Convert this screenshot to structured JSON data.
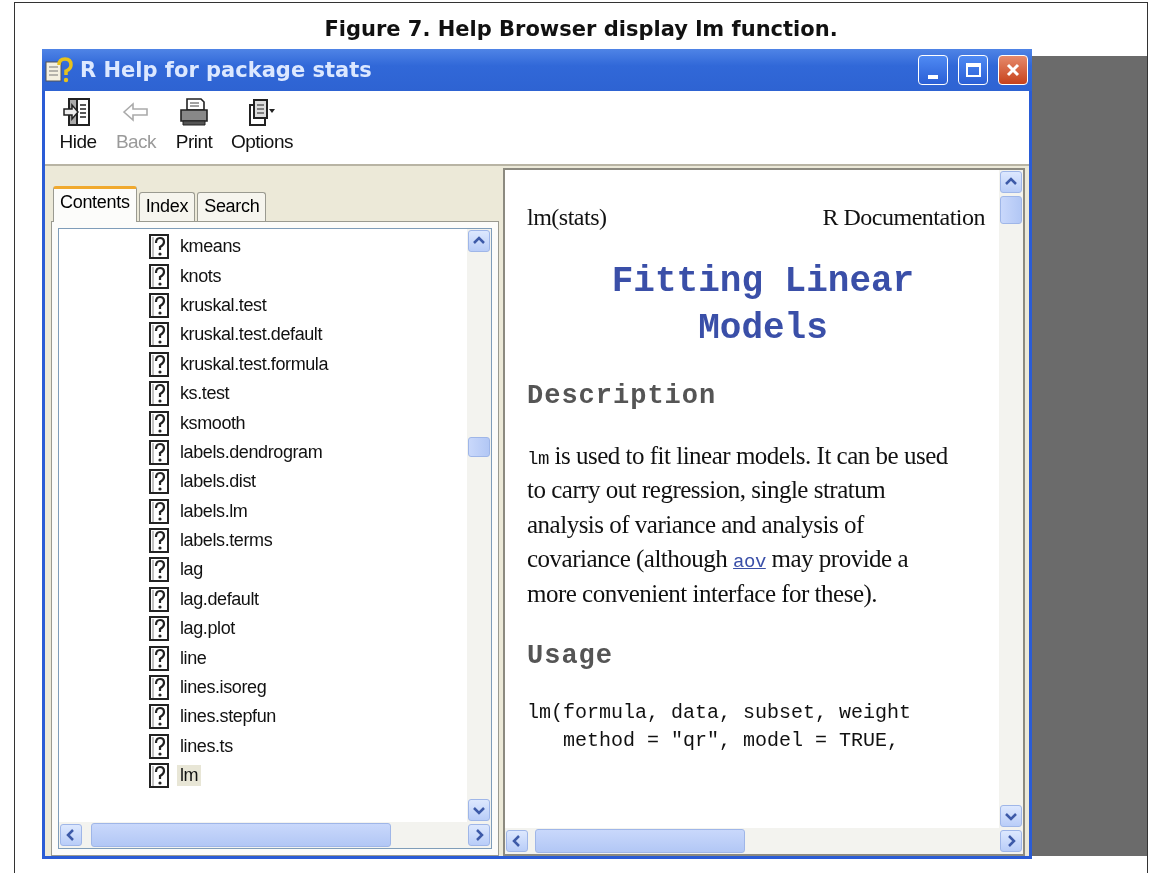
{
  "figure_caption": "Figure 7.  Help Browser display lm function.",
  "window": {
    "title": "R Help for package stats",
    "controls": [
      {
        "kind": "minimize"
      },
      {
        "kind": "maximize"
      },
      {
        "kind": "close"
      }
    ]
  },
  "toolbar": [
    {
      "kind": "hide",
      "label": "Hide",
      "disabled": false
    },
    {
      "kind": "back",
      "label": "Back",
      "disabled": true
    },
    {
      "kind": "print",
      "label": "Print",
      "disabled": false
    },
    {
      "kind": "options",
      "label": "Options",
      "disabled": false
    }
  ],
  "tabs": [
    {
      "label": "Contents",
      "selected": true
    },
    {
      "label": "Index",
      "selected": false
    },
    {
      "label": "Search",
      "selected": false
    }
  ],
  "contents": [
    {
      "label": "kmeans",
      "selected": false
    },
    {
      "label": "knots",
      "selected": false
    },
    {
      "label": "kruskal.test",
      "selected": false
    },
    {
      "label": "kruskal.test.default",
      "selected": false
    },
    {
      "label": "kruskal.test.formula",
      "selected": false
    },
    {
      "label": "ks.test",
      "selected": false
    },
    {
      "label": "ksmooth",
      "selected": false
    },
    {
      "label": "labels.dendrogram",
      "selected": false
    },
    {
      "label": "labels.dist",
      "selected": false
    },
    {
      "label": "labels.lm",
      "selected": false
    },
    {
      "label": "labels.terms",
      "selected": false
    },
    {
      "label": "lag",
      "selected": false
    },
    {
      "label": "lag.default",
      "selected": false
    },
    {
      "label": "lag.plot",
      "selected": false
    },
    {
      "label": "line",
      "selected": false
    },
    {
      "label": "lines.isoreg",
      "selected": false
    },
    {
      "label": "lines.stepfun",
      "selected": false
    },
    {
      "label": "lines.ts",
      "selected": false
    },
    {
      "label": "lm",
      "selected": true
    }
  ],
  "document": {
    "header_left": "lm(stats)",
    "header_right": "R Documentation",
    "title": "Fitting Linear Models",
    "sections": [
      {
        "heading": "Description",
        "kind": "paragraph",
        "parts": [
          {
            "kind": "code",
            "text": "lm"
          },
          {
            "kind": "text",
            "text": " is used to fit linear models. It can be used to carry out regression, single stratum analysis of variance and analysis of covariance (although "
          },
          {
            "kind": "link",
            "text": "aov"
          },
          {
            "kind": "text",
            "text": " may provide a more convenient interface for these)."
          }
        ]
      },
      {
        "heading": "Usage",
        "kind": "code",
        "lines": [
          "lm(formula, data, subset, weight",
          "   method = \"qr\", model = TRUE,"
        ]
      }
    ]
  }
}
